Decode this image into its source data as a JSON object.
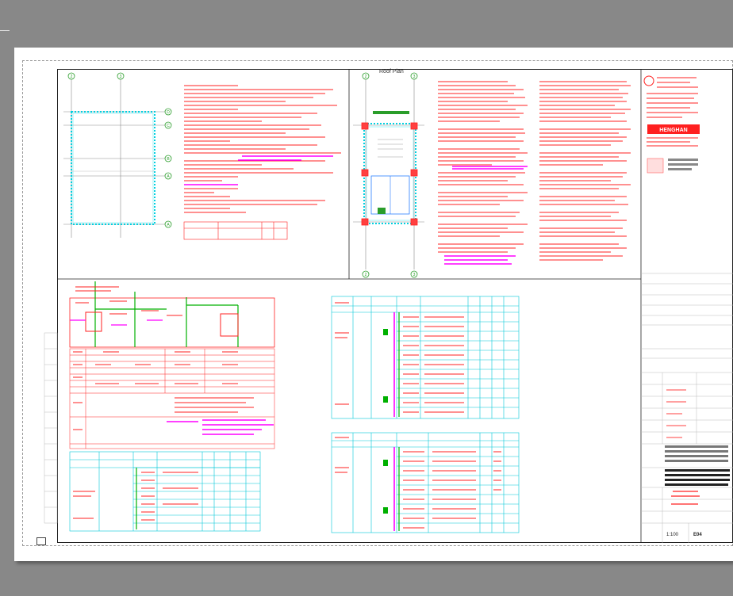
{
  "viewer": {
    "background_color": "#888888",
    "paper_color": "#ffffff"
  },
  "drawing": {
    "roof_plan_title": "Roof Plan",
    "grid_labels_left": [
      "2",
      "3"
    ],
    "grid_labels_right": [
      "2",
      "3"
    ],
    "axis_labels": [
      "D",
      "C",
      "B",
      "A"
    ],
    "scale": "1:100",
    "sheet_no": "E04",
    "company_brand": "HENGHAN",
    "label_colors": {
      "red_notes": "#ff2020",
      "magenta_notes": "#ff00ff",
      "cyan_tables": "#00c8d8",
      "green_lines": "#00b000"
    }
  }
}
